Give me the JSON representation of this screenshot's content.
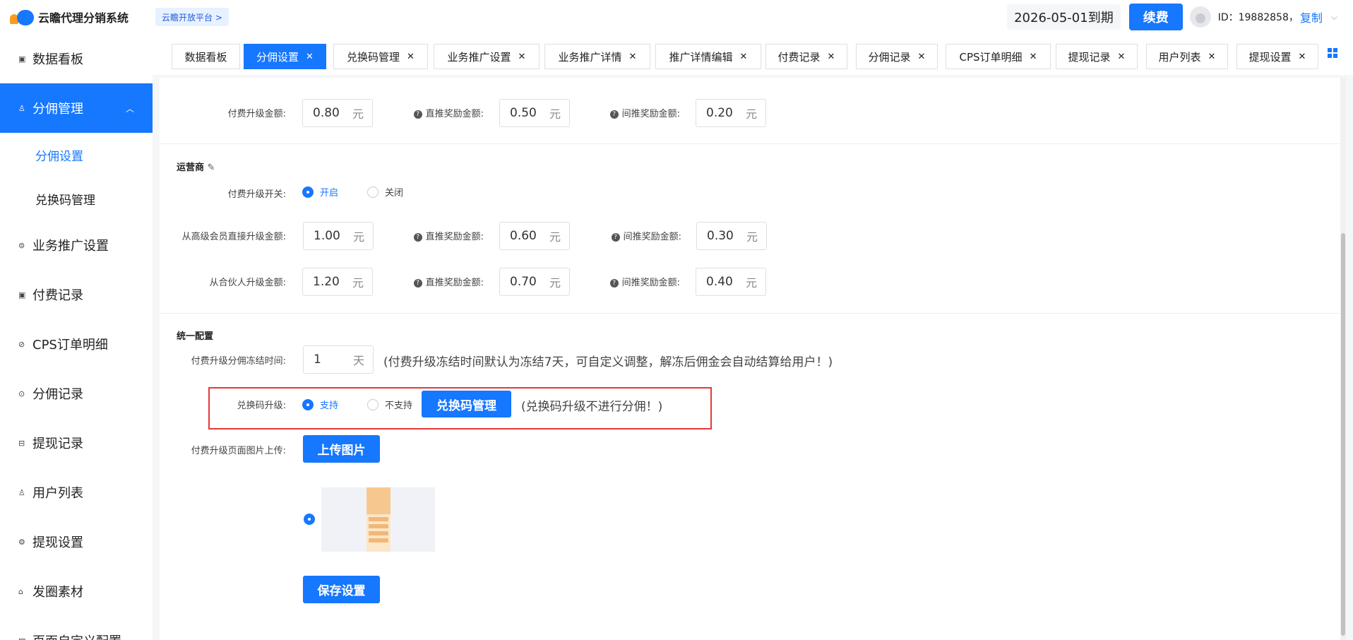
{
  "app": {
    "title": "云瞻代理分销系统",
    "platform_link": "云瞻开放平台 >",
    "expire_text": "2026-05-01到期",
    "renew_label": "续费",
    "user_id": "ID：19882858，",
    "copy_label": "复制"
  },
  "sidebar": {
    "items": [
      {
        "icon": "dashboard-icon",
        "glyph": "▣",
        "label": "数据看板"
      },
      {
        "icon": "user-icon",
        "glyph": "♙",
        "label": "分佣管理"
      },
      {
        "icon": "promotion-icon",
        "glyph": "⊜",
        "label": "业务推广设置"
      },
      {
        "icon": "payment-icon",
        "glyph": "▣",
        "label": "付费记录"
      },
      {
        "icon": "order-icon",
        "glyph": "⊘",
        "label": "CPS订单明细"
      },
      {
        "icon": "commission-icon",
        "glyph": "⊙",
        "label": "分佣记录"
      },
      {
        "icon": "withdraw-icon",
        "glyph": "⊟",
        "label": "提现记录"
      },
      {
        "icon": "users-icon",
        "glyph": "♙",
        "label": "用户列表"
      },
      {
        "icon": "settings-icon",
        "glyph": "⚙",
        "label": "提现设置"
      },
      {
        "icon": "material-icon",
        "glyph": "⌂",
        "label": "发圈素材"
      },
      {
        "icon": "page-config-icon",
        "glyph": "▤",
        "label": "页面自定义配置"
      }
    ],
    "sub_items": [
      {
        "label": "分佣设置"
      },
      {
        "label": "兑换码管理"
      }
    ]
  },
  "tabs": [
    {
      "label": "数据看板",
      "closable": false
    },
    {
      "label": "分佣设置",
      "closable": true
    },
    {
      "label": "兑换码管理",
      "closable": true
    },
    {
      "label": "业务推广设置",
      "closable": true
    },
    {
      "label": "业务推广详情",
      "closable": true
    },
    {
      "label": "推广详情编辑",
      "closable": true
    },
    {
      "label": "付费记录",
      "closable": true
    },
    {
      "label": "分佣记录",
      "closable": true
    },
    {
      "label": "CPS订单明细",
      "closable": true
    },
    {
      "label": "提现记录",
      "closable": true
    },
    {
      "label": "用户列表",
      "closable": true
    },
    {
      "label": "提现设置",
      "closable": true
    }
  ],
  "form": {
    "unit_yuan": "元",
    "unit_day": "天",
    "top_row": {
      "upgrade_label": "付费升级金额:",
      "upgrade_value": "0.80",
      "direct_label": "直推奖励金额:",
      "direct_value": "0.50",
      "indirect_label": "间推奖励金额:",
      "indirect_value": "0.20"
    },
    "operator": {
      "title": "运营商",
      "switch_label": "付费升级开关:",
      "switch_on": "开启",
      "switch_off": "关闭",
      "row1": {
        "label": "从高级会员直接升级金额:",
        "value": "1.00",
        "direct_label": "直推奖励金额:",
        "direct_value": "0.60",
        "indirect_label": "间推奖励金额:",
        "indirect_value": "0.30"
      },
      "row2": {
        "label": "从合伙人升级金额:",
        "value": "1.20",
        "direct_label": "直推奖励金额:",
        "direct_value": "0.70",
        "indirect_label": "间推奖励金额:",
        "indirect_value": "0.40"
      }
    },
    "unified": {
      "title": "统一配置",
      "freeze_label": "付费升级分佣冻结时间:",
      "freeze_value": "1",
      "freeze_hint": "(付费升级冻结时间默认为冻结7天，可自定义调整，解冻后佣金会自动结算给用户！)",
      "code_label": "兑换码升级:",
      "code_support": "支持",
      "code_unsupport": "不支持",
      "code_manage_btn": "兑换码管理",
      "code_hint": "(兑换码升级不进行分佣！)",
      "upload_label": "付费升级页面图片上传:",
      "upload_btn": "上传图片",
      "save_btn": "保存设置"
    }
  }
}
